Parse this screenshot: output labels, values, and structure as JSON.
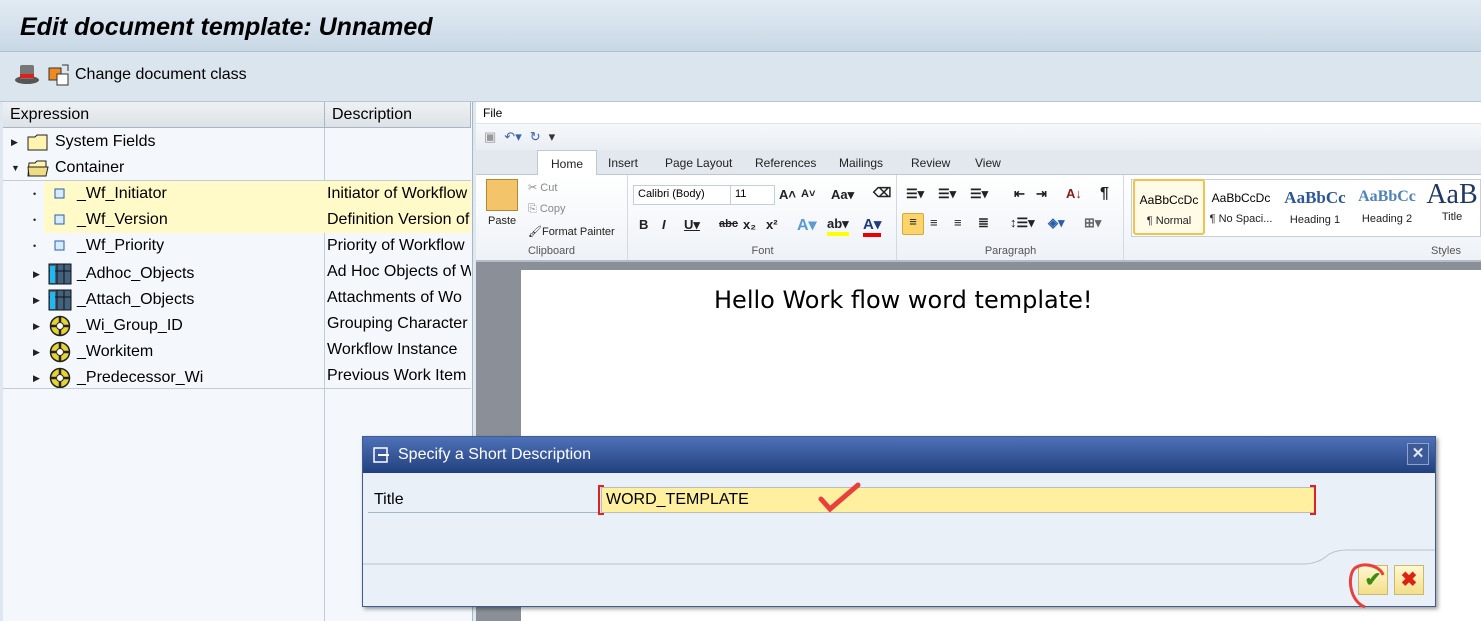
{
  "window": {
    "title": "Edit document template: Unnamed"
  },
  "toolbar": {
    "change_class_label": "Change document class"
  },
  "tree": {
    "columns": [
      "Expression",
      "Description"
    ],
    "rows": [
      {
        "expression": "System Fields",
        "description": "",
        "icon": "folder-icon",
        "toggle": "collapsed",
        "highlight": false
      },
      {
        "expression": "Container",
        "description": "",
        "icon": "folder-open-icon",
        "toggle": "expanded",
        "highlight": false
      },
      {
        "expression": "_Wf_Initiator",
        "description": "Initiator of Workflow",
        "icon": "element-icon",
        "toggle": "leaf",
        "highlight": true
      },
      {
        "expression": "_Wf_Version",
        "description": "Definition Version of",
        "icon": "element-icon",
        "toggle": "leaf",
        "highlight": true
      },
      {
        "expression": "_Wf_Priority",
        "description": "Priority of Workflow",
        "icon": "element-icon",
        "toggle": "leaf",
        "highlight": false
      },
      {
        "expression": "_Adhoc_Objects",
        "description": "Ad Hoc Objects of W",
        "icon": "table-icon",
        "toggle": "collapsed",
        "highlight": false
      },
      {
        "expression": "_Attach_Objects",
        "description": "Attachments of Wo",
        "icon": "table-icon",
        "toggle": "collapsed",
        "highlight": false
      },
      {
        "expression": "_Wi_Group_ID",
        "description": "Grouping Character",
        "icon": "object-icon",
        "toggle": "collapsed",
        "highlight": false
      },
      {
        "expression": "_Workitem",
        "description": "Workflow Instance",
        "icon": "object-icon",
        "toggle": "collapsed",
        "highlight": false
      },
      {
        "expression": "_Predecessor_Wi",
        "description": "Previous Work Item",
        "icon": "object-icon",
        "toggle": "collapsed",
        "highlight": false
      }
    ]
  },
  "word": {
    "file_tab": "File",
    "tabs": [
      "Home",
      "Insert",
      "Page Layout",
      "References",
      "Mailings",
      "Review",
      "View"
    ],
    "clipboard": {
      "paste": "Paste",
      "cut": "Cut",
      "copy": "Copy",
      "format_painter": "Format Painter",
      "label": "Clipboard"
    },
    "font": {
      "name": "Calibri (Body)",
      "size": "11",
      "label": "Font"
    },
    "paragraph": {
      "label": "Paragraph"
    },
    "styles": {
      "label": "Styles",
      "items": [
        {
          "preview": "AaBbCcDc",
          "name": "¶ Normal"
        },
        {
          "preview": "AaBbCcDc",
          "name": "¶ No Spaci..."
        },
        {
          "preview": "AaBbCc",
          "name": "Heading 1"
        },
        {
          "preview": "AaBbCc",
          "name": "Heading 2"
        },
        {
          "preview": "AaB",
          "name": "Title"
        }
      ]
    },
    "document_text": "Hello Work flow word template!"
  },
  "dialog": {
    "title": "Specify a Short Description",
    "field_label": "Title",
    "field_value": "WORD_TEMPLATE",
    "ok_symbol": "✔",
    "cancel_symbol": "✖",
    "close_symbol": "✕"
  },
  "colors": {
    "accent": "#22407e",
    "highlight": "#fffac8",
    "annotation": "#e8413c"
  }
}
